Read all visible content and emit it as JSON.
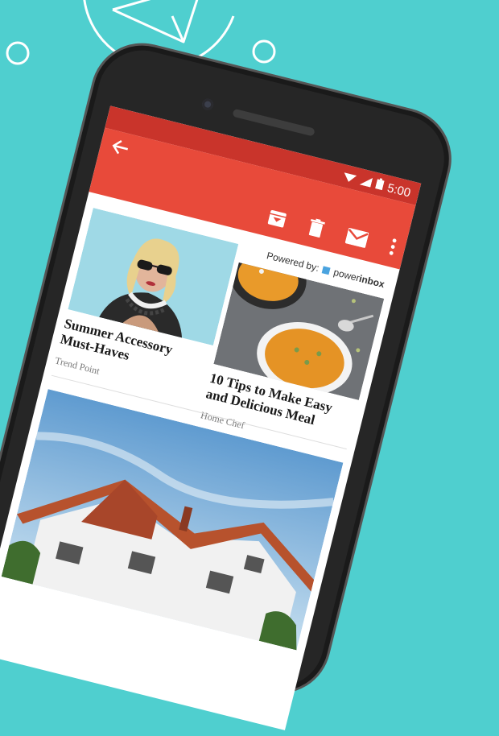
{
  "status": {
    "time": "5:00"
  },
  "toolbar": {
    "back_icon": "arrow-left-icon",
    "actions": [
      "archive-icon",
      "trash-icon",
      "mail-icon",
      "more-vert-icon"
    ]
  },
  "powered": {
    "prefix": "Powered by:",
    "brand_light": "power",
    "brand_bold": "inbox"
  },
  "cards": [
    {
      "title_line1": "Summer Accessory",
      "title_line2": "Must-Haves",
      "source": "Trend Point"
    },
    {
      "title_line1": "10 Tips to Make Easy",
      "title_line2": "and Delicious Meal",
      "source": "Home Chef"
    }
  ],
  "colors": {
    "background": "#4fcfcf",
    "appbar": "#e84a3a",
    "statusbar": "#c9342b"
  }
}
